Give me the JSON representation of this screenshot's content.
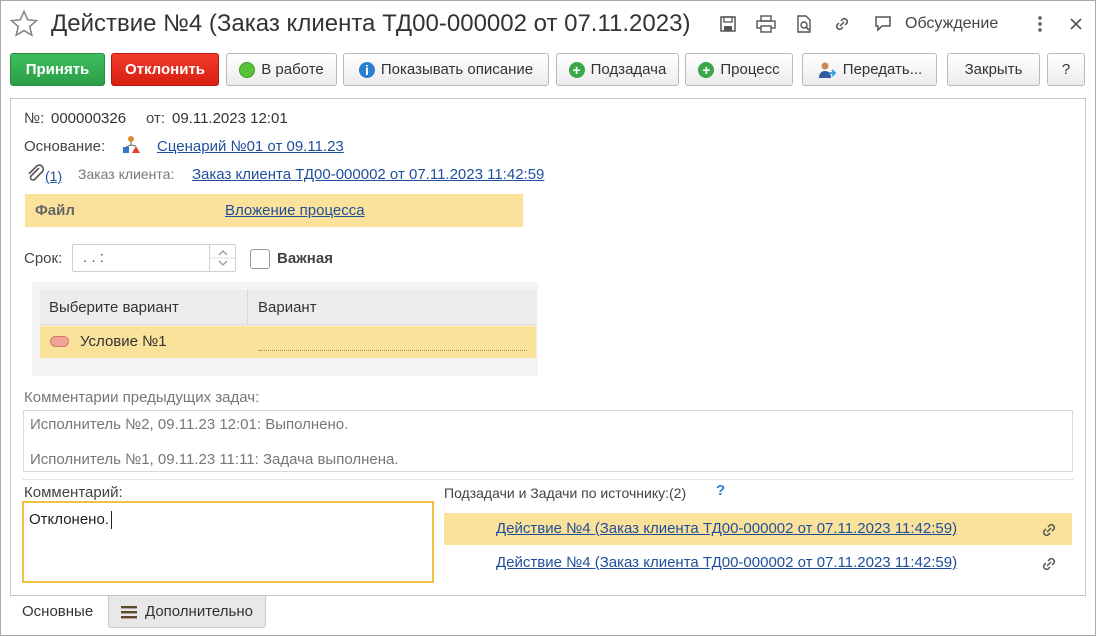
{
  "window": {
    "title": "Действие №4 (Заказ клиента ТД00-000002 от 07.11.2023)",
    "discussion_label": "Обсуждение"
  },
  "toolbar": {
    "accept": "Принять",
    "reject": "Отклонить",
    "in_progress": "В работе",
    "show_description": "Показывать описание",
    "subtask": "Подзадача",
    "process": "Процесс",
    "transfer": "Передать...",
    "close": "Закрыть",
    "help": "?"
  },
  "form": {
    "number_label": "№:",
    "number_value": "000000326",
    "date_label": "от:",
    "date_value": "09.11.2023 12:01",
    "basis_label": "Основание:",
    "basis_link": "Сценарий №01 от 09.11.23",
    "attachments_count": "(1)",
    "customer_order_label": "Заказ клиента:",
    "customer_order_link": "Заказ клиента ТД00-000002 от 07.11.2023 11:42:59",
    "file_label": "Файл",
    "file_link": "Вложение процесса",
    "deadline_label": "Срок:",
    "deadline_value": " .  .     :",
    "important_label": "Важная",
    "grid_col1": "Выберите вариант",
    "grid_col2": "Вариант",
    "grid_row1": "Условие №1",
    "prev_comments_label": "Комментарии предыдущих задач:",
    "prev_comments": [
      "Исполнитель №2, 09.11.23 12:01: Выполнено.",
      "Исполнитель №1, 09.11.23 11:11: Задача выполнена."
    ],
    "comment_label": "Комментарий:",
    "comment_value": "Отклонено.",
    "subtasks_label": "Подзадачи и Задачи по источнику:(2)",
    "subtasks_help": "?",
    "subtasks": [
      "Действие №4 (Заказ клиента ТД00-000002 от 07.11.2023 11:42:59)",
      "Действие №4 (Заказ клиента ТД00-000002 от 07.11.2023 11:42:59)"
    ]
  },
  "tabs": {
    "main": "Основные",
    "additional": "Дополнительно"
  },
  "colors": {
    "accept": "#2fa84f",
    "reject": "#e02a1c",
    "highlight": "#fbe29a",
    "link": "#1f4f9c",
    "info": "#2a7fd0"
  },
  "icons": [
    "star-icon",
    "save-icon",
    "print-icon",
    "preview-icon",
    "link-icon",
    "discussion-icon",
    "more-icon",
    "close-icon",
    "scenario-icon",
    "paperclip-icon",
    "person-arrow-icon",
    "hamburger-icon"
  ]
}
